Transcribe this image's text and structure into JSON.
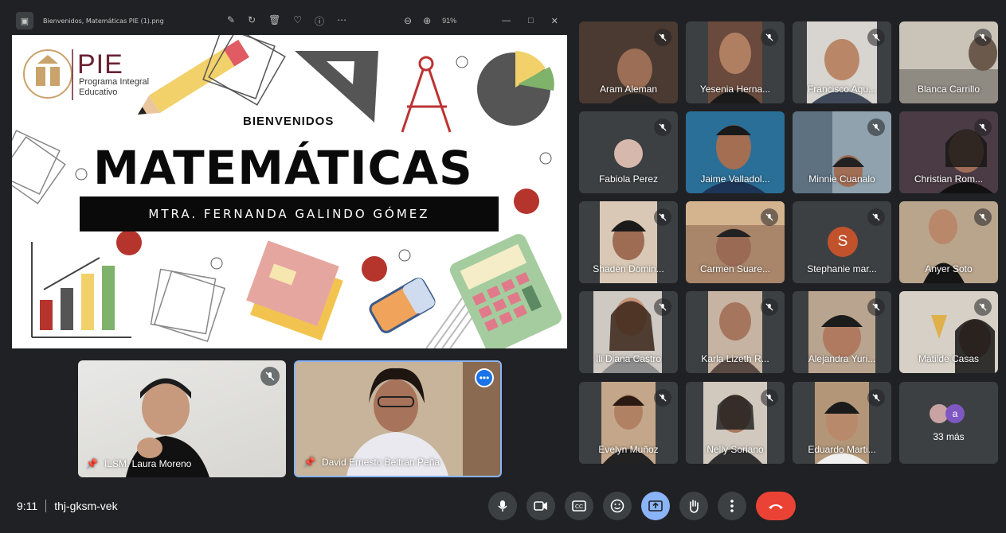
{
  "viewer": {
    "filename": "Bienvenidos, Matemáticas PIE (1).png",
    "zoom": "91%",
    "icons": [
      "edit-icon",
      "rotate-icon",
      "delete-icon",
      "favorite-icon",
      "info-icon",
      "more-icon",
      "zoom-out-icon",
      "zoom-in-icon"
    ]
  },
  "slide": {
    "logo_word": "PIE",
    "logo_sub": "Programa Integral Educativo",
    "welcome": "BIENVENIDOS",
    "title": "MATEMÁTICAS",
    "teacher": "MTRA. FERNANDA GALINDO GÓMEZ"
  },
  "pinned": [
    {
      "name": "ILSM. Laura Moreno",
      "muted": true
    },
    {
      "name": "David Ernesto Beltrán Peña",
      "active": true
    }
  ],
  "participants": [
    {
      "name": "Aram Aleman"
    },
    {
      "name": "Yesenia Herna..."
    },
    {
      "name": "Francisco Agu..."
    },
    {
      "name": "Blanca Carrillo"
    },
    {
      "name": "Fabiola Perez",
      "avatar": "photo"
    },
    {
      "name": "Jaime Valladol..."
    },
    {
      "name": "Minnie Cuanalo"
    },
    {
      "name": "Christian Rom..."
    },
    {
      "name": "Shaden Domin..."
    },
    {
      "name": "Carmen Suare..."
    },
    {
      "name": "Stephanie mar...",
      "avatar_letter": "S"
    },
    {
      "name": "Anyer Soto"
    },
    {
      "name": "Ili Diana Castro"
    },
    {
      "name": "Karla Lizeth R..."
    },
    {
      "name": "Alejandra Yuri..."
    },
    {
      "name": "Matilde Casas"
    },
    {
      "name": "Evelyn Muñoz"
    },
    {
      "name": "Nelly Soriano"
    },
    {
      "name": "Eduardo Marti..."
    }
  ],
  "overflow": {
    "label": "33 más",
    "avatar_letter": "a"
  },
  "meeting": {
    "time": "9:11",
    "code": "thj-gksm-vek"
  },
  "controls": [
    "mic-icon",
    "camera-icon",
    "captions-icon",
    "emoji-icon",
    "present-icon",
    "raise-hand-icon",
    "more-options-icon",
    "end-call-icon"
  ],
  "colors": {
    "background": "#202124",
    "tile": "#3c4043",
    "accent_blue": "#8ab4f8",
    "end_call": "#ea4335",
    "brand_maroon": "#6b2233"
  }
}
